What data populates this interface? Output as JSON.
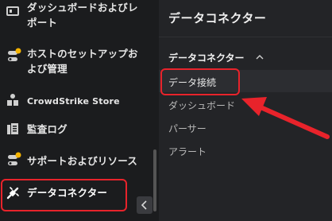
{
  "sidebar": {
    "items": [
      {
        "label_line1": "ダッシュボードおよびレ",
        "label_line2": "ポート",
        "icon": "dashboard-icon"
      },
      {
        "label_line1": "ホストのセットアップお",
        "label_line2": "よび管理",
        "icon": "host-setup-icon"
      },
      {
        "label": "CrowdStrike Store",
        "icon": "store-icon"
      },
      {
        "label": "監査ログ",
        "icon": "audit-log-icon"
      },
      {
        "label": "サポートおよびリソース",
        "icon": "support-icon"
      },
      {
        "label": "データコネクター",
        "icon": "data-connector-icon",
        "active": true
      }
    ],
    "collapse_icon": "chevron-left-icon"
  },
  "panel": {
    "title": "データコネクター",
    "section": {
      "label": "データコネクター",
      "expanded": true,
      "items": [
        {
          "label": "データ接続",
          "active": true
        },
        {
          "label": "ダッシュボード"
        },
        {
          "label": "パーサー"
        },
        {
          "label": "アラート"
        }
      ]
    }
  },
  "colors": {
    "highlight": "#e8232b",
    "notification_dot": "#f5b400",
    "sidebar_bg": "#1b1c1e",
    "panel_bg": "#232427"
  }
}
